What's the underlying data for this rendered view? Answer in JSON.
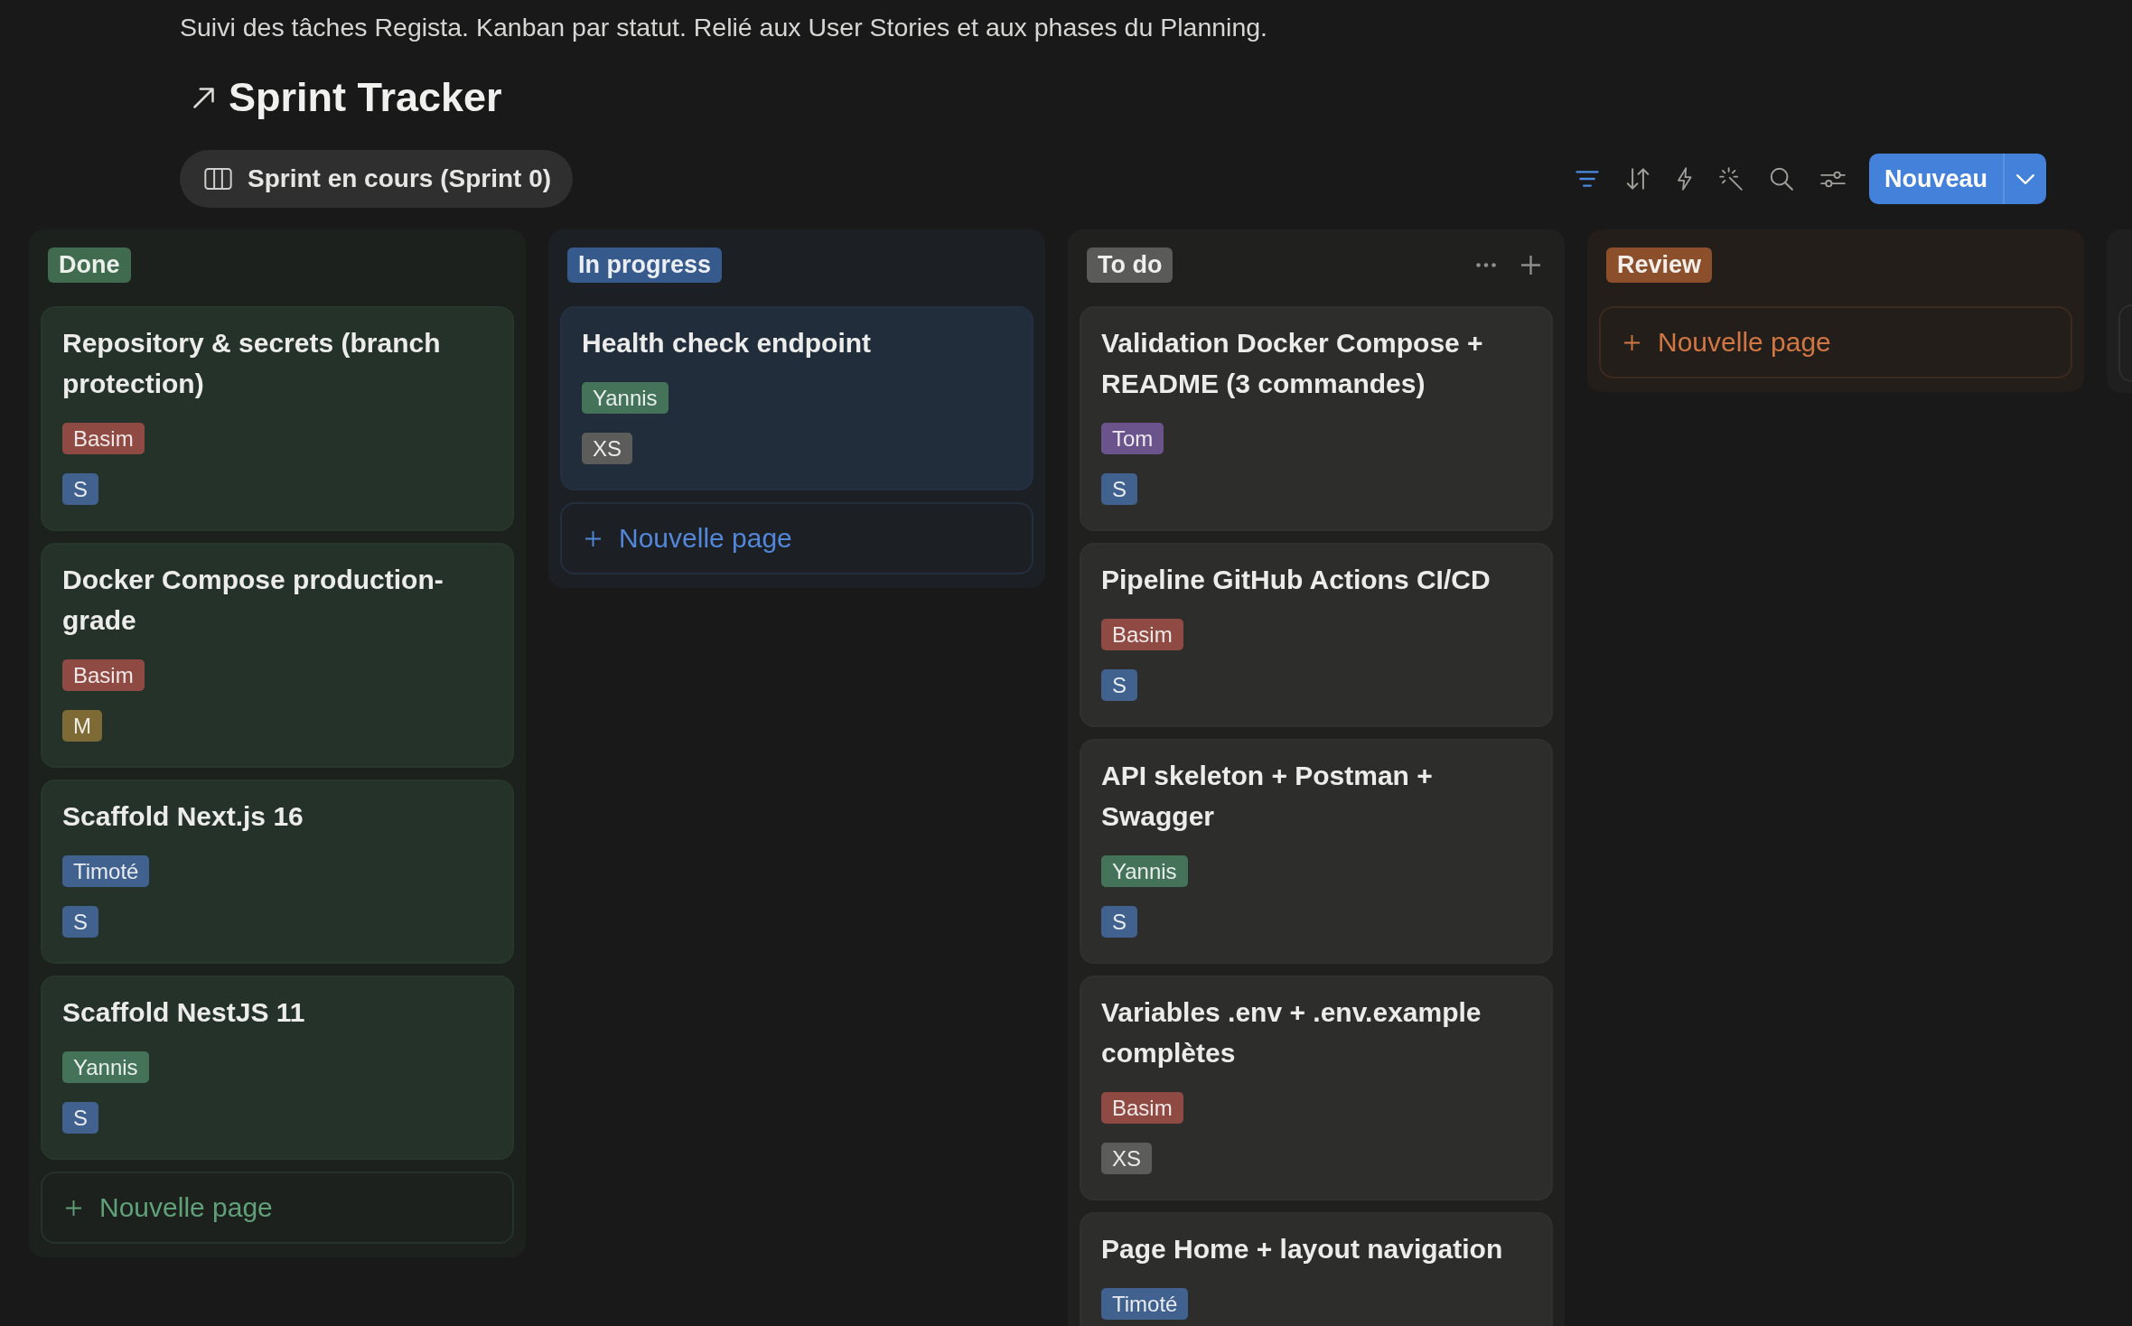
{
  "description": "Suivi des tâches Regista. Kanban par statut. Relié aux User Stories et aux phases du Planning.",
  "title": "Sprint Tracker",
  "views": [
    {
      "label": "Sprint en cours (Sprint 0)",
      "selected": true
    }
  ],
  "toolbar": {
    "tools": [
      {
        "kind": "filter",
        "active": true
      },
      {
        "kind": "sort",
        "active": false
      },
      {
        "kind": "automation",
        "active": false
      },
      {
        "kind": "ai",
        "active": false
      },
      {
        "kind": "search",
        "active": false
      },
      {
        "kind": "settings",
        "active": false
      }
    ],
    "new_button": {
      "label": "Nouveau"
    }
  },
  "columns": [
    {
      "label": "Done",
      "color": "#406b4e",
      "hovered": false,
      "cards": [
        {
          "title": "Repository & secrets (branch protection)",
          "tags": [
            {
              "label": "Basim",
              "color": "#8f4a44"
            },
            {
              "label": "S",
              "color": "#41618f"
            }
          ]
        },
        {
          "title": "Docker Compose production-grade",
          "tags": [
            {
              "label": "Basim",
              "color": "#8f4a44"
            },
            {
              "label": "M",
              "color": "#7d6a35"
            }
          ]
        },
        {
          "title": "Scaffold Next.js 16",
          "tags": [
            {
              "label": "Timoté",
              "color": "#41618f"
            },
            {
              "label": "S",
              "color": "#41618f"
            }
          ]
        },
        {
          "title": "Scaffold NestJS 11",
          "tags": [
            {
              "label": "Yannis",
              "color": "#44735a"
            },
            {
              "label": "S",
              "color": "#41618f"
            }
          ]
        }
      ],
      "add_label": "Nouvelle page"
    },
    {
      "label": "In progress",
      "color": "#375a8c",
      "hovered": false,
      "cards": [
        {
          "title": "Health check endpoint",
          "tags": [
            {
              "label": "Yannis",
              "color": "#44735a"
            },
            {
              "label": "XS",
              "color": "#5c5c5a"
            }
          ]
        }
      ],
      "add_label": "Nouvelle page"
    },
    {
      "label": "To do",
      "color": "#5a5a58",
      "hovered": true,
      "cards": [
        {
          "title": "Validation Docker Compose + README (3 commandes)",
          "tags": [
            {
              "label": "Tom",
              "color": "#6b548c"
            },
            {
              "label": "S",
              "color": "#41618f"
            }
          ]
        },
        {
          "title": "Pipeline GitHub Actions CI/CD",
          "tags": [
            {
              "label": "Basim",
              "color": "#8f4a44"
            },
            {
              "label": "S",
              "color": "#41618f"
            }
          ]
        },
        {
          "title": "API skeleton + Postman + Swagger",
          "tags": [
            {
              "label": "Yannis",
              "color": "#44735a"
            },
            {
              "label": "S",
              "color": "#41618f"
            }
          ]
        },
        {
          "title": "Variables .env + .env.example complètes",
          "tags": [
            {
              "label": "Basim",
              "color": "#8f4a44"
            },
            {
              "label": "XS",
              "color": "#5c5c5a"
            }
          ]
        },
        {
          "title": "Page Home + layout navigation",
          "tags": [
            {
              "label": "Timoté",
              "color": "#41618f"
            }
          ]
        }
      ]
    },
    {
      "label": "Review",
      "color": "#8b4f2c",
      "hovered": false,
      "add_label": "Nouvelle page"
    }
  ]
}
